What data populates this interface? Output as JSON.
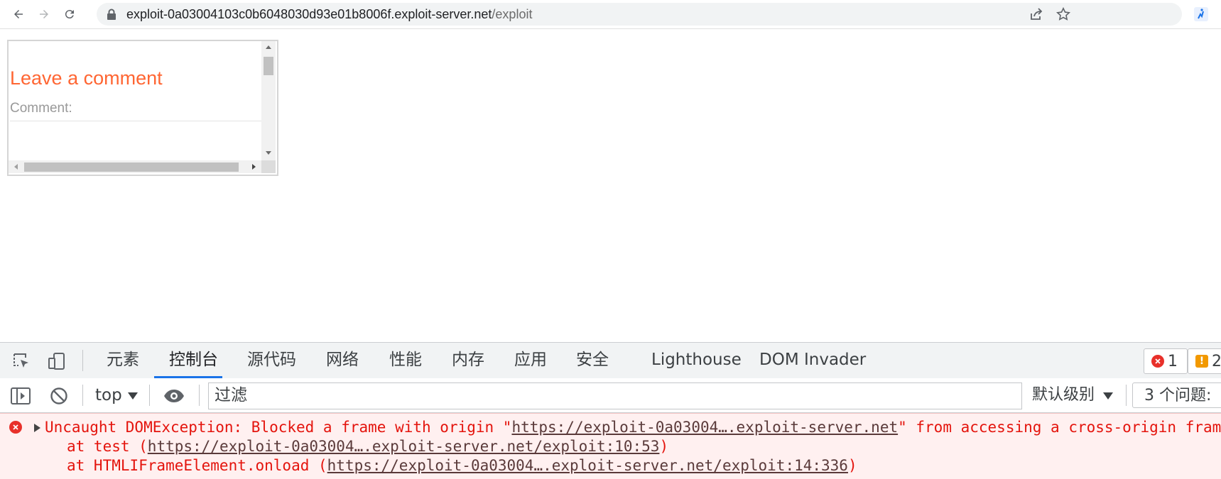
{
  "browser": {
    "url_host": "exploit-0a03004103c0b6048030d93e01b8006f.exploit-server.net",
    "url_path": "/exploit",
    "icons": [
      "back-icon",
      "forward-icon",
      "reload-icon",
      "lock-icon",
      "share-icon",
      "star-icon",
      "extension-icon"
    ]
  },
  "iframe": {
    "heading": "Leave a comment",
    "comment_label": "Comment:",
    "heading_color": "#ff6633"
  },
  "devtools": {
    "tabs": [
      {
        "label": "元素"
      },
      {
        "label": "控制台",
        "active": true
      },
      {
        "label": "源代码"
      },
      {
        "label": "网络"
      },
      {
        "label": "性能"
      },
      {
        "label": "内存"
      },
      {
        "label": "应用"
      },
      {
        "label": "安全"
      },
      {
        "label": "Lighthouse"
      },
      {
        "label": "DOM Invader"
      }
    ],
    "error_count": "1",
    "warning_count": "2",
    "context": "top",
    "filter_placeholder": "过滤",
    "levels": "默认级别",
    "issues": "3 个问题:",
    "accent_color": "#1a73e8",
    "error_color": "#e4140d"
  },
  "console": {
    "message_prefix": "Uncaught DOMException: Blocked a frame with origin \"",
    "message_link": "https://exploit-0a03004….exploit-server.net",
    "message_suffix": "\" from accessing a cross-origin frame.",
    "stack": [
      {
        "prefix": "at test (",
        "link": "https://exploit-0a03004….exploit-server.net/exploit:10:53",
        "suffix": ")"
      },
      {
        "prefix": "at HTMLIFrameElement.onload (",
        "link": "https://exploit-0a03004….exploit-server.net/exploit:14:336",
        "suffix": ")"
      }
    ]
  }
}
